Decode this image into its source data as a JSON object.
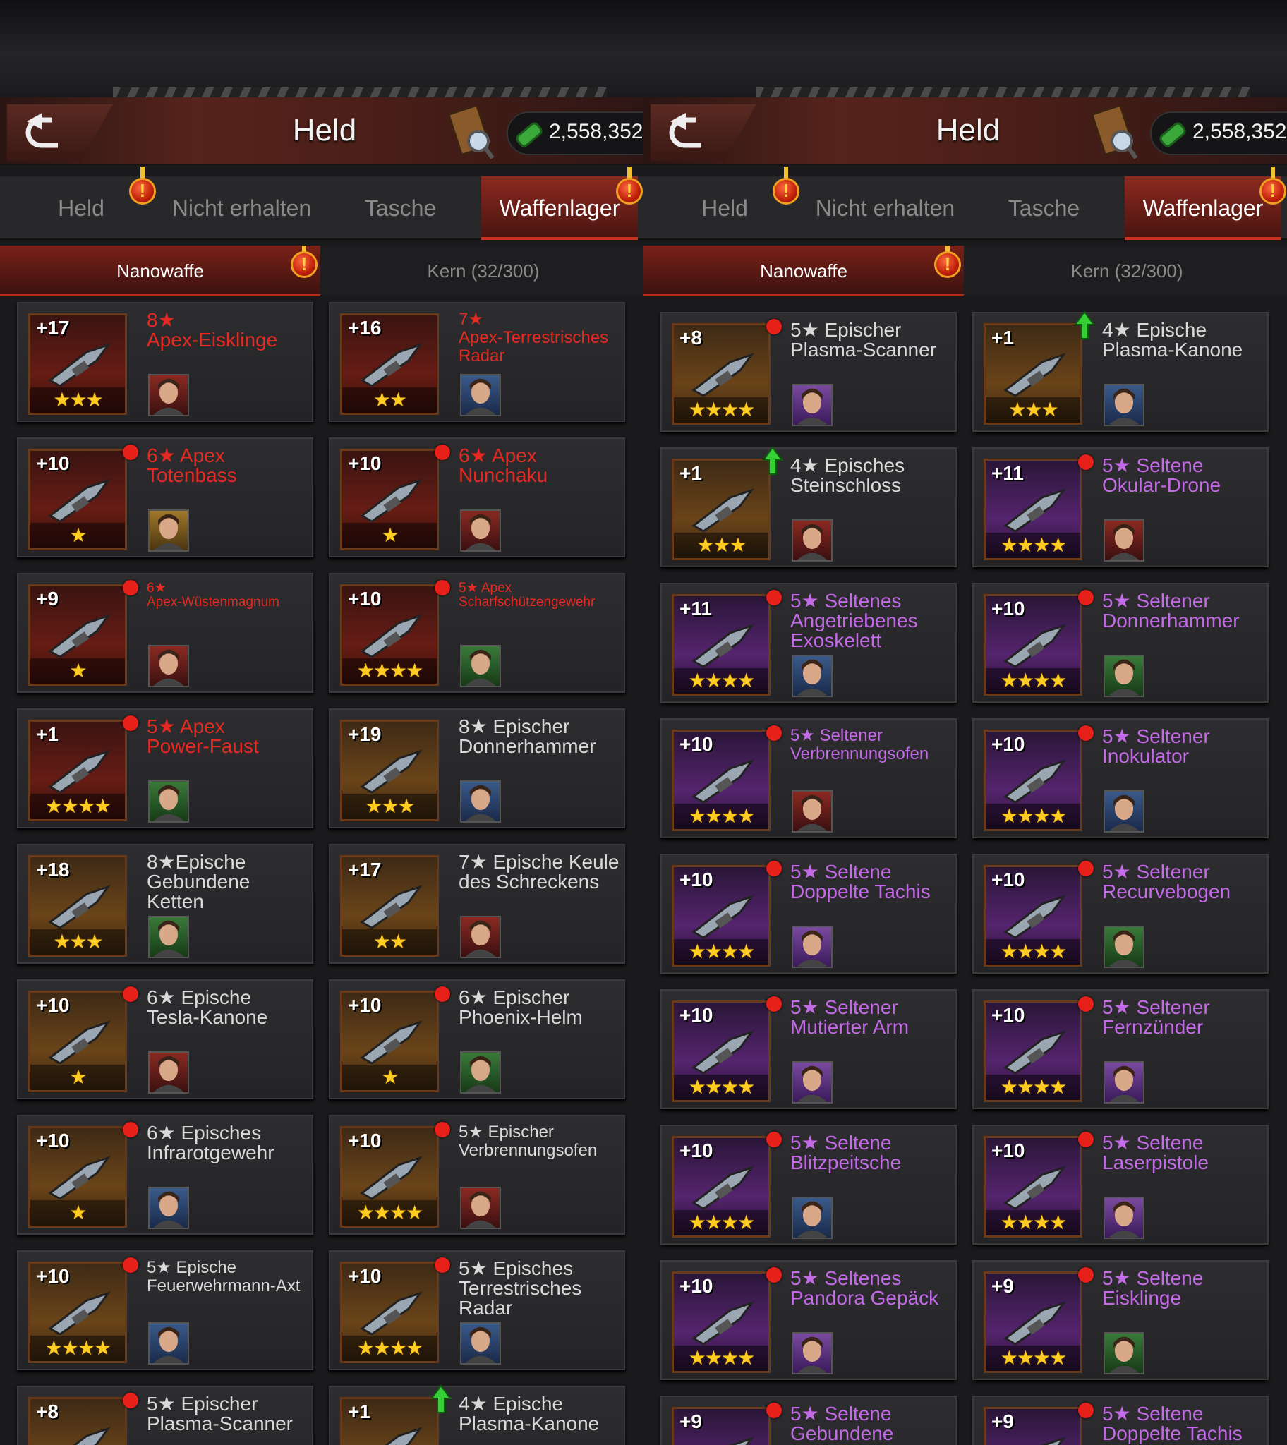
{
  "screens": [
    {
      "title": "Held",
      "currency": "2,558,352",
      "tabs": [
        "Held",
        "Nicht erhalten",
        "Tasche",
        "Waffenlager"
      ],
      "active_tab": 3,
      "subtabs": [
        "Nanowaffe",
        "Kern (32/300)"
      ],
      "items": [
        {
          "level": "+17",
          "stars": "★★★",
          "name": "8★\nApex-Eisklinge",
          "color": "red",
          "frame": "red",
          "portrait": "pred",
          "indicator": "none"
        },
        {
          "level": "+16",
          "stars": "★★",
          "name": "7★\nApex-Terrestrisches\nRadar",
          "color": "red",
          "frame": "red",
          "portrait": "pblue",
          "indicator": "none",
          "size": "medium"
        },
        {
          "level": "+10",
          "stars": "★",
          "name": "6★ Apex\nTotenbass",
          "color": "red",
          "frame": "red",
          "portrait": "pgold",
          "indicator": "dot"
        },
        {
          "level": "+10",
          "stars": "★",
          "name": "6★ Apex\nNunchaku",
          "color": "red",
          "frame": "red",
          "portrait": "pred",
          "indicator": "dot"
        },
        {
          "level": "+9",
          "stars": "★",
          "name": "6★\nApex-Wüstenmagnum",
          "color": "red",
          "frame": "red",
          "portrait": "pred",
          "indicator": "dot",
          "size": "small"
        },
        {
          "level": "+10",
          "stars": "★★★★",
          "name": "5★ Apex\nScharfschützengewehr",
          "color": "red",
          "frame": "red",
          "portrait": "pgreen",
          "indicator": "dot",
          "size": "small"
        },
        {
          "level": "+1",
          "stars": "★★★★",
          "name": "5★ Apex\nPower-Faust",
          "color": "red",
          "frame": "red",
          "portrait": "pgreen",
          "indicator": "dot"
        },
        {
          "level": "+19",
          "stars": "★★★",
          "name": "8★ Epischer\nDonnerhammer",
          "color": "white",
          "frame": "gold",
          "portrait": "pblue",
          "indicator": "none"
        },
        {
          "level": "+18",
          "stars": "★★★",
          "name": "8★Epische\nGebundene\nKetten",
          "color": "white",
          "frame": "gold",
          "portrait": "pgreen",
          "indicator": "none"
        },
        {
          "level": "+17",
          "stars": "★★",
          "name": "7★ Epische Keule\ndes Schreckens",
          "color": "white",
          "frame": "gold",
          "portrait": "pred",
          "indicator": "none"
        },
        {
          "level": "+10",
          "stars": "★",
          "name": "6★ Epische\nTesla-Kanone",
          "color": "white",
          "frame": "gold",
          "portrait": "pred",
          "indicator": "dot"
        },
        {
          "level": "+10",
          "stars": "★",
          "name": "6★ Epischer\nPhoenix-Helm",
          "color": "white",
          "frame": "gold",
          "portrait": "pgreen",
          "indicator": "dot"
        },
        {
          "level": "+10",
          "stars": "★",
          "name": "6★ Episches\nInfrarotgewehr",
          "color": "white",
          "frame": "gold",
          "portrait": "pblue",
          "indicator": "dot"
        },
        {
          "level": "+10",
          "stars": "★★★★",
          "name": "5★ Epischer\nVerbrennungsofen",
          "color": "white",
          "frame": "gold",
          "portrait": "pred",
          "indicator": "dot",
          "size": "medium"
        },
        {
          "level": "+10",
          "stars": "★★★★",
          "name": "5★ Epische\nFeuerwehrmann-Axt",
          "color": "white",
          "frame": "gold",
          "portrait": "pblue",
          "indicator": "dot",
          "size": "medium"
        },
        {
          "level": "+10",
          "stars": "★★★★",
          "name": "5★ Episches\nTerrestrisches\nRadar",
          "color": "white",
          "frame": "gold",
          "portrait": "pblue",
          "indicator": "dot"
        },
        {
          "level": "+8",
          "stars": "★★★★",
          "name": "5★ Epischer\nPlasma-Scanner",
          "color": "white",
          "frame": "gold",
          "portrait": "ppurple",
          "indicator": "dot"
        },
        {
          "level": "+1",
          "stars": "★★★",
          "name": "4★ Epische\nPlasma-Kanone",
          "color": "white",
          "frame": "gold",
          "portrait": "pblue",
          "indicator": "arrow"
        }
      ]
    },
    {
      "title": "Held",
      "currency": "2,558,352",
      "tabs": [
        "Held",
        "Nicht erhalten",
        "Tasche",
        "Waffenlager"
      ],
      "active_tab": 3,
      "subtabs": [
        "Nanowaffe",
        "Kern (32/300)"
      ],
      "items": [
        {
          "level": "+8",
          "stars": "★★★★",
          "name": "5★ Epischer\nPlasma-Scanner",
          "color": "white",
          "frame": "gold",
          "portrait": "ppurple",
          "indicator": "dot"
        },
        {
          "level": "+1",
          "stars": "★★★",
          "name": "4★ Epische\nPlasma-Kanone",
          "color": "white",
          "frame": "gold",
          "portrait": "pblue",
          "indicator": "arrow"
        },
        {
          "level": "+1",
          "stars": "★★★",
          "name": "4★ Episches\nSteinschloss",
          "color": "white",
          "frame": "gold",
          "portrait": "pred",
          "indicator": "arrow"
        },
        {
          "level": "+11",
          "stars": "★★★★",
          "name": "5★ Seltene\nOkular-Drone",
          "color": "purple",
          "frame": "purple",
          "portrait": "pred",
          "indicator": "dot"
        },
        {
          "level": "+11",
          "stars": "★★★★",
          "name": "5★ Seltenes\nAngetriebenes\nExoskelett",
          "color": "purple",
          "frame": "purple",
          "portrait": "pblue",
          "indicator": "dot"
        },
        {
          "level": "+10",
          "stars": "★★★★",
          "name": "5★ Seltener\nDonnerhammer",
          "color": "purple",
          "frame": "purple",
          "portrait": "pgreen",
          "indicator": "dot"
        },
        {
          "level": "+10",
          "stars": "★★★★",
          "name": "5★ Seltener\nVerbrennungsofen",
          "color": "purple",
          "frame": "purple",
          "portrait": "pred",
          "indicator": "dot",
          "size": "medium"
        },
        {
          "level": "+10",
          "stars": "★★★★",
          "name": "5★ Seltener\nInokulator",
          "color": "purple",
          "frame": "purple",
          "portrait": "pblue",
          "indicator": "dot"
        },
        {
          "level": "+10",
          "stars": "★★★★",
          "name": "5★ Seltene\nDoppelte Tachis",
          "color": "purple",
          "frame": "purple",
          "portrait": "ppurple",
          "indicator": "dot"
        },
        {
          "level": "+10",
          "stars": "★★★★",
          "name": "5★ Seltener\nRecurvebogen",
          "color": "purple",
          "frame": "purple",
          "portrait": "pgreen",
          "indicator": "dot"
        },
        {
          "level": "+10",
          "stars": "★★★★",
          "name": "5★ Seltener\nMutierter Arm",
          "color": "purple",
          "frame": "purple",
          "portrait": "ppurple",
          "indicator": "dot"
        },
        {
          "level": "+10",
          "stars": "★★★★",
          "name": "5★ Seltener\nFernzünder",
          "color": "purple",
          "frame": "purple",
          "portrait": "ppurple",
          "indicator": "dot"
        },
        {
          "level": "+10",
          "stars": "★★★★",
          "name": "5★ Seltene\nBlitzpeitsche",
          "color": "purple",
          "frame": "purple",
          "portrait": "pblue",
          "indicator": "dot"
        },
        {
          "level": "+10",
          "stars": "★★★★",
          "name": "5★ Seltene\nLaserpistole",
          "color": "purple",
          "frame": "purple",
          "portrait": "ppurple",
          "indicator": "dot"
        },
        {
          "level": "+10",
          "stars": "★★★★",
          "name": "5★ Seltenes\nPandora Gepäck",
          "color": "purple",
          "frame": "purple",
          "portrait": "ppurple",
          "indicator": "dot"
        },
        {
          "level": "+9",
          "stars": "★★★★",
          "name": "5★ Seltene\nEisklinge",
          "color": "purple",
          "frame": "purple",
          "portrait": "pgreen",
          "indicator": "dot"
        },
        {
          "level": "+9",
          "stars": "★★★★",
          "name": "5★ Seltene\nGebundene",
          "color": "purple",
          "frame": "purple",
          "portrait": "ppurple",
          "indicator": "dot"
        },
        {
          "level": "+9",
          "stars": "★★★★",
          "name": "5★ Seltene\nDoppelte Tachis",
          "color": "purple",
          "frame": "purple",
          "portrait": "ppurple",
          "indicator": "dot"
        }
      ]
    }
  ]
}
